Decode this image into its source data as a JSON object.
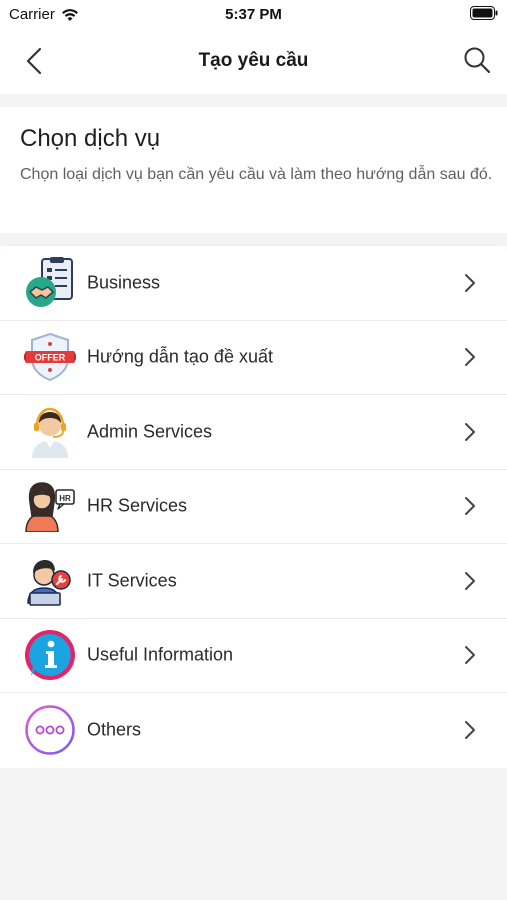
{
  "status_bar": {
    "carrier": "Carrier",
    "time": "5:37 PM"
  },
  "nav": {
    "title": "Tạo yêu cầu"
  },
  "intro": {
    "title": "Chọn dịch vụ",
    "description": "Chọn loại dịch vụ bạn cần yêu cầu và làm theo hướng dẫn sau đó."
  },
  "services": [
    {
      "label": "Business",
      "icon": "business-handshake-icon"
    },
    {
      "label": "Hướng dẫn tạo đề xuất",
      "icon": "offer-badge-icon"
    },
    {
      "label": "Admin Services",
      "icon": "headset-agent-icon"
    },
    {
      "label": "HR Services",
      "icon": "hr-person-icon"
    },
    {
      "label": "IT Services",
      "icon": "it-technician-icon"
    },
    {
      "label": "Useful Information",
      "icon": "info-icon"
    },
    {
      "label": "Others",
      "icon": "more-dots-icon"
    }
  ],
  "colors": {
    "background": "#f4f4f5",
    "surface": "#ffffff",
    "offer_red": "#e23b3b",
    "info_blue": "#1aa5e0",
    "info_pink": "#e5236b",
    "others_purple": "#b44bd6"
  }
}
